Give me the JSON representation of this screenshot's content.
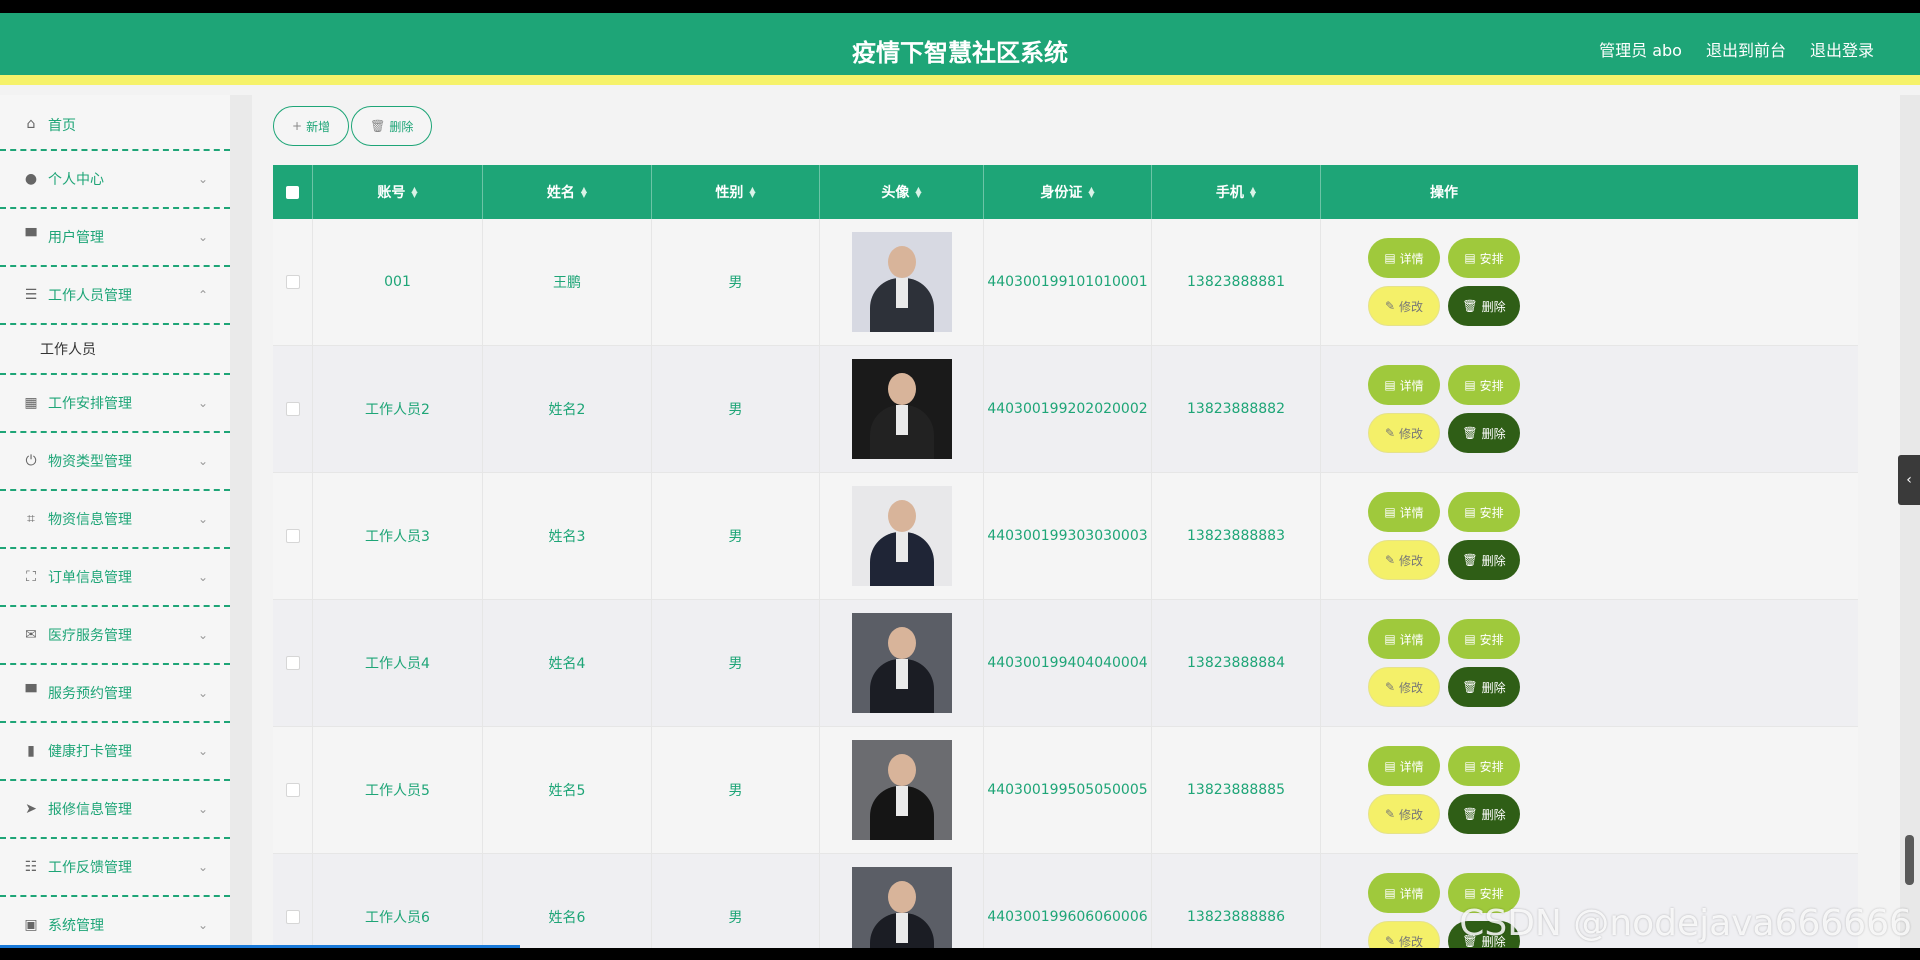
{
  "header": {
    "title": "疫情下智慧社区系统",
    "admin": "管理员 abo",
    "to_front": "退出到前台",
    "logout": "退出登录"
  },
  "sidebar": {
    "items": [
      {
        "label": "首页",
        "icon": "home-icon",
        "glyph": "⌂",
        "chevron": ""
      },
      {
        "label": "个人中心",
        "icon": "user-icon",
        "glyph": "●",
        "chevron": "⌄"
      },
      {
        "label": "用户管理",
        "icon": "users-icon",
        "glyph": "▀",
        "chevron": "⌄"
      },
      {
        "label": "工作人员管理",
        "icon": "list-icon",
        "glyph": "☰",
        "chevron": "⌃"
      },
      {
        "label": "工作安排管理",
        "icon": "grid-icon",
        "glyph": "▦",
        "chevron": "⌄"
      },
      {
        "label": "物资类型管理",
        "icon": "power-icon",
        "glyph": "⏻",
        "chevron": "⌄"
      },
      {
        "label": "物资信息管理",
        "icon": "crop-icon",
        "glyph": "⌗",
        "chevron": "⌄"
      },
      {
        "label": "订单信息管理",
        "icon": "fullscreen-icon",
        "glyph": "⛶",
        "chevron": "⌄"
      },
      {
        "label": "医疗服务管理",
        "icon": "mail-icon",
        "glyph": "✉",
        "chevron": "⌄"
      },
      {
        "label": "服务预约管理",
        "icon": "folder-icon",
        "glyph": "▀",
        "chevron": "⌄"
      },
      {
        "label": "健康打卡管理",
        "icon": "mic-icon",
        "glyph": "▮",
        "chevron": "⌄"
      },
      {
        "label": "报修信息管理",
        "icon": "navigation-icon",
        "glyph": "➤",
        "chevron": "⌄"
      },
      {
        "label": "工作反馈管理",
        "icon": "sliders-icon",
        "glyph": "☷",
        "chevron": "⌄"
      },
      {
        "label": "系统管理",
        "icon": "trash-icon",
        "glyph": "▣",
        "chevron": "⌄"
      }
    ],
    "sub_item": "工作人员"
  },
  "toolbar": {
    "add": "新增",
    "add_icon": "+",
    "delete": "删除",
    "delete_icon": "🗑"
  },
  "table": {
    "columns": [
      "账号",
      "姓名",
      "性别",
      "头像",
      "身份证",
      "手机",
      "操作"
    ],
    "rows": [
      {
        "account": "001",
        "name": "王鹏",
        "gender": "男",
        "id_card": "440300199101010001",
        "phone": "13823888881",
        "avatar_bg": "#d7d9e2",
        "suit": "#2d3139"
      },
      {
        "account": "工作人员2",
        "name": "姓名2",
        "gender": "男",
        "id_card": "440300199202020002",
        "phone": "13823888882",
        "avatar_bg": "#1a1a1a",
        "suit": "#222222"
      },
      {
        "account": "工作人员3",
        "name": "姓名3",
        "gender": "男",
        "id_card": "440300199303030003",
        "phone": "13823888883",
        "avatar_bg": "#e8e8ea",
        "suit": "#1f2536"
      },
      {
        "account": "工作人员4",
        "name": "姓名4",
        "gender": "男",
        "id_card": "440300199404040004",
        "phone": "13823888884",
        "avatar_bg": "#5b5e66",
        "suit": "#1b1d24"
      },
      {
        "account": "工作人员5",
        "name": "姓名5",
        "gender": "男",
        "id_card": "440300199505050005",
        "phone": "13823888885",
        "avatar_bg": "#6b6c70",
        "suit": "#151515"
      },
      {
        "account": "工作人员6",
        "name": "姓名6",
        "gender": "男",
        "id_card": "440300199606060006",
        "phone": "13823888886",
        "avatar_bg": "#5b5e66",
        "suit": "#1b1d24"
      }
    ],
    "ops": {
      "detail": "详情",
      "arrange": "安排",
      "edit": "修改",
      "delete": "删除"
    }
  },
  "watermark": "CSDN @nodejava666666",
  "colors": {
    "primary": "#1ea577",
    "accent_bar": "#f6f26a",
    "btn_green": "#9fc93c",
    "btn_yellow": "#f4f069",
    "btn_dark": "#2f5e16"
  }
}
